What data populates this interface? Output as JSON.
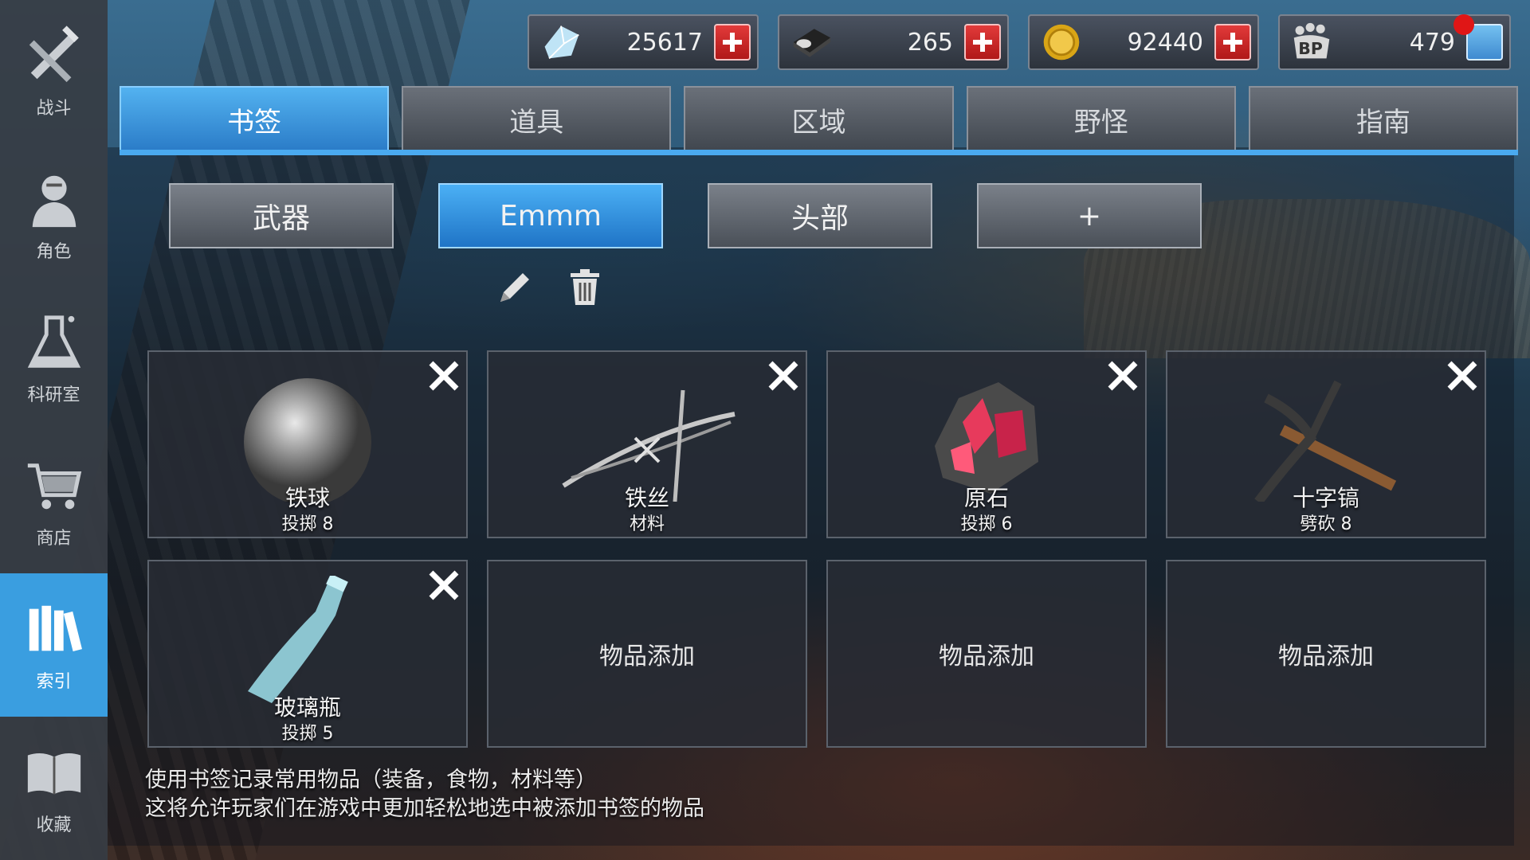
{
  "sidebar": {
    "items": [
      {
        "label": "战斗",
        "icon": "crossed-weapons-icon"
      },
      {
        "label": "角色",
        "icon": "character-icon"
      },
      {
        "label": "科研室",
        "icon": "flask-icon"
      },
      {
        "label": "商店",
        "icon": "shopping-cart-icon"
      },
      {
        "label": "索引",
        "icon": "books-icon",
        "active": true
      },
      {
        "label": "收藏",
        "icon": "open-book-icon"
      }
    ]
  },
  "currencies": [
    {
      "name": "diamond",
      "value": "25617"
    },
    {
      "name": "disk",
      "value": "265"
    },
    {
      "name": "coin",
      "value": "92440"
    },
    {
      "name": "bp",
      "icon_text": "BP",
      "value": "479"
    }
  ],
  "tabs": [
    {
      "label": "书签",
      "active": true
    },
    {
      "label": "道具"
    },
    {
      "label": "区域"
    },
    {
      "label": "野怪"
    },
    {
      "label": "指南"
    }
  ],
  "sub_tabs": [
    {
      "label": "武器"
    },
    {
      "label": "Emmm",
      "active": true
    },
    {
      "label": "头部"
    },
    {
      "label": "+"
    }
  ],
  "items": [
    {
      "name": "铁球",
      "sub": "投掷 8"
    },
    {
      "name": "铁丝",
      "sub": "材料"
    },
    {
      "name": "原石",
      "sub": "投掷 6"
    },
    {
      "name": "十字镐",
      "sub": "劈砍 8"
    },
    {
      "name": "玻璃瓶",
      "sub": "投掷 5"
    },
    {
      "empty_label": "物品添加"
    },
    {
      "empty_label": "物品添加"
    },
    {
      "empty_label": "物品添加"
    }
  ],
  "hint": {
    "line1": "使用书签记录常用物品（装备，食物，材料等）",
    "line2": "这将允许玩家们在游戏中更加轻松地选中被添加书签的物品"
  }
}
